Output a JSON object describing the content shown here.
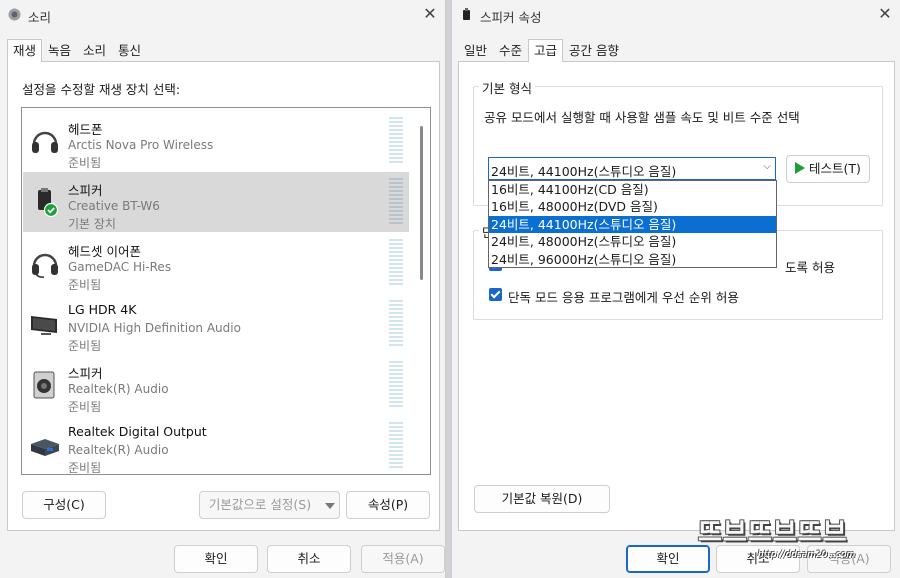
{
  "left_window": {
    "title": "소리",
    "tabs": [
      "재생",
      "녹음",
      "소리",
      "통신"
    ],
    "active_tab": 0,
    "caption": "설정을 수정할 재생 장치 선택:",
    "devices": [
      {
        "name": "헤드폰",
        "sub": "Arctis Nova Pro Wireless",
        "status": "준비됨",
        "icon": "headphones-icon"
      },
      {
        "name": "스피커",
        "sub": "Creative BT-W6",
        "status": "기본 장치",
        "icon": "bluetooth-dongle-icon"
      },
      {
        "name": "헤드셋 이어폰",
        "sub": "GameDAC Hi-Res",
        "status": "준비됨",
        "icon": "headset-icon"
      },
      {
        "name": "LG HDR 4K",
        "sub": "NVIDIA High Definition Audio",
        "status": "준비됨",
        "icon": "monitor-icon"
      },
      {
        "name": "스피커",
        "sub": "Realtek(R) Audio",
        "status": "준비됨",
        "icon": "speaker-icon"
      },
      {
        "name": "Realtek Digital Output",
        "sub": "Realtek(R) Audio",
        "status": "준비됨",
        "icon": "digital-output-icon"
      }
    ],
    "selected_device": 1,
    "configure_label": "구성(C)",
    "set_default_label": "기본값으로 설정(S)",
    "properties_label": "속성(P)",
    "ok_label": "확인",
    "cancel_label": "취소",
    "apply_label": "적용(A)"
  },
  "right_window": {
    "title": "스피커 속성",
    "tabs": [
      "일반",
      "수준",
      "고급",
      "공간 음향"
    ],
    "active_tab": 2,
    "format_group_label": "기본 형식",
    "format_desc": "공유 모드에서 실행할 때 사용할 샘플 속도 및 비트 수준 선택",
    "combo_value": "24비트, 44100Hz(스튜디오 음질)",
    "options": [
      "16비트, 44100Hz(CD 음질)",
      "16비트, 48000Hz(DVD 음질)",
      "24비트, 44100Hz(스튜디오 음질)",
      "24비트, 48000Hz(스튜디오 음질)",
      "24비트, 96000Hz(스튜디오 음질)"
    ],
    "selected_option": 2,
    "test_label": "테스트(T)",
    "exclusive_group_label": "단",
    "exclusive_check1_tail": "도록 허용",
    "exclusive_check2": "단독 모드 응용 프로그램에게 우선 순위 허용",
    "restore_label": "기본값 복원(D)",
    "ok_label": "확인",
    "cancel_label": "취소",
    "apply_label": "적용(A)"
  },
  "watermark": {
    "text": "뜨브뜨브뜨브",
    "url": "http://ddsam20...com"
  }
}
